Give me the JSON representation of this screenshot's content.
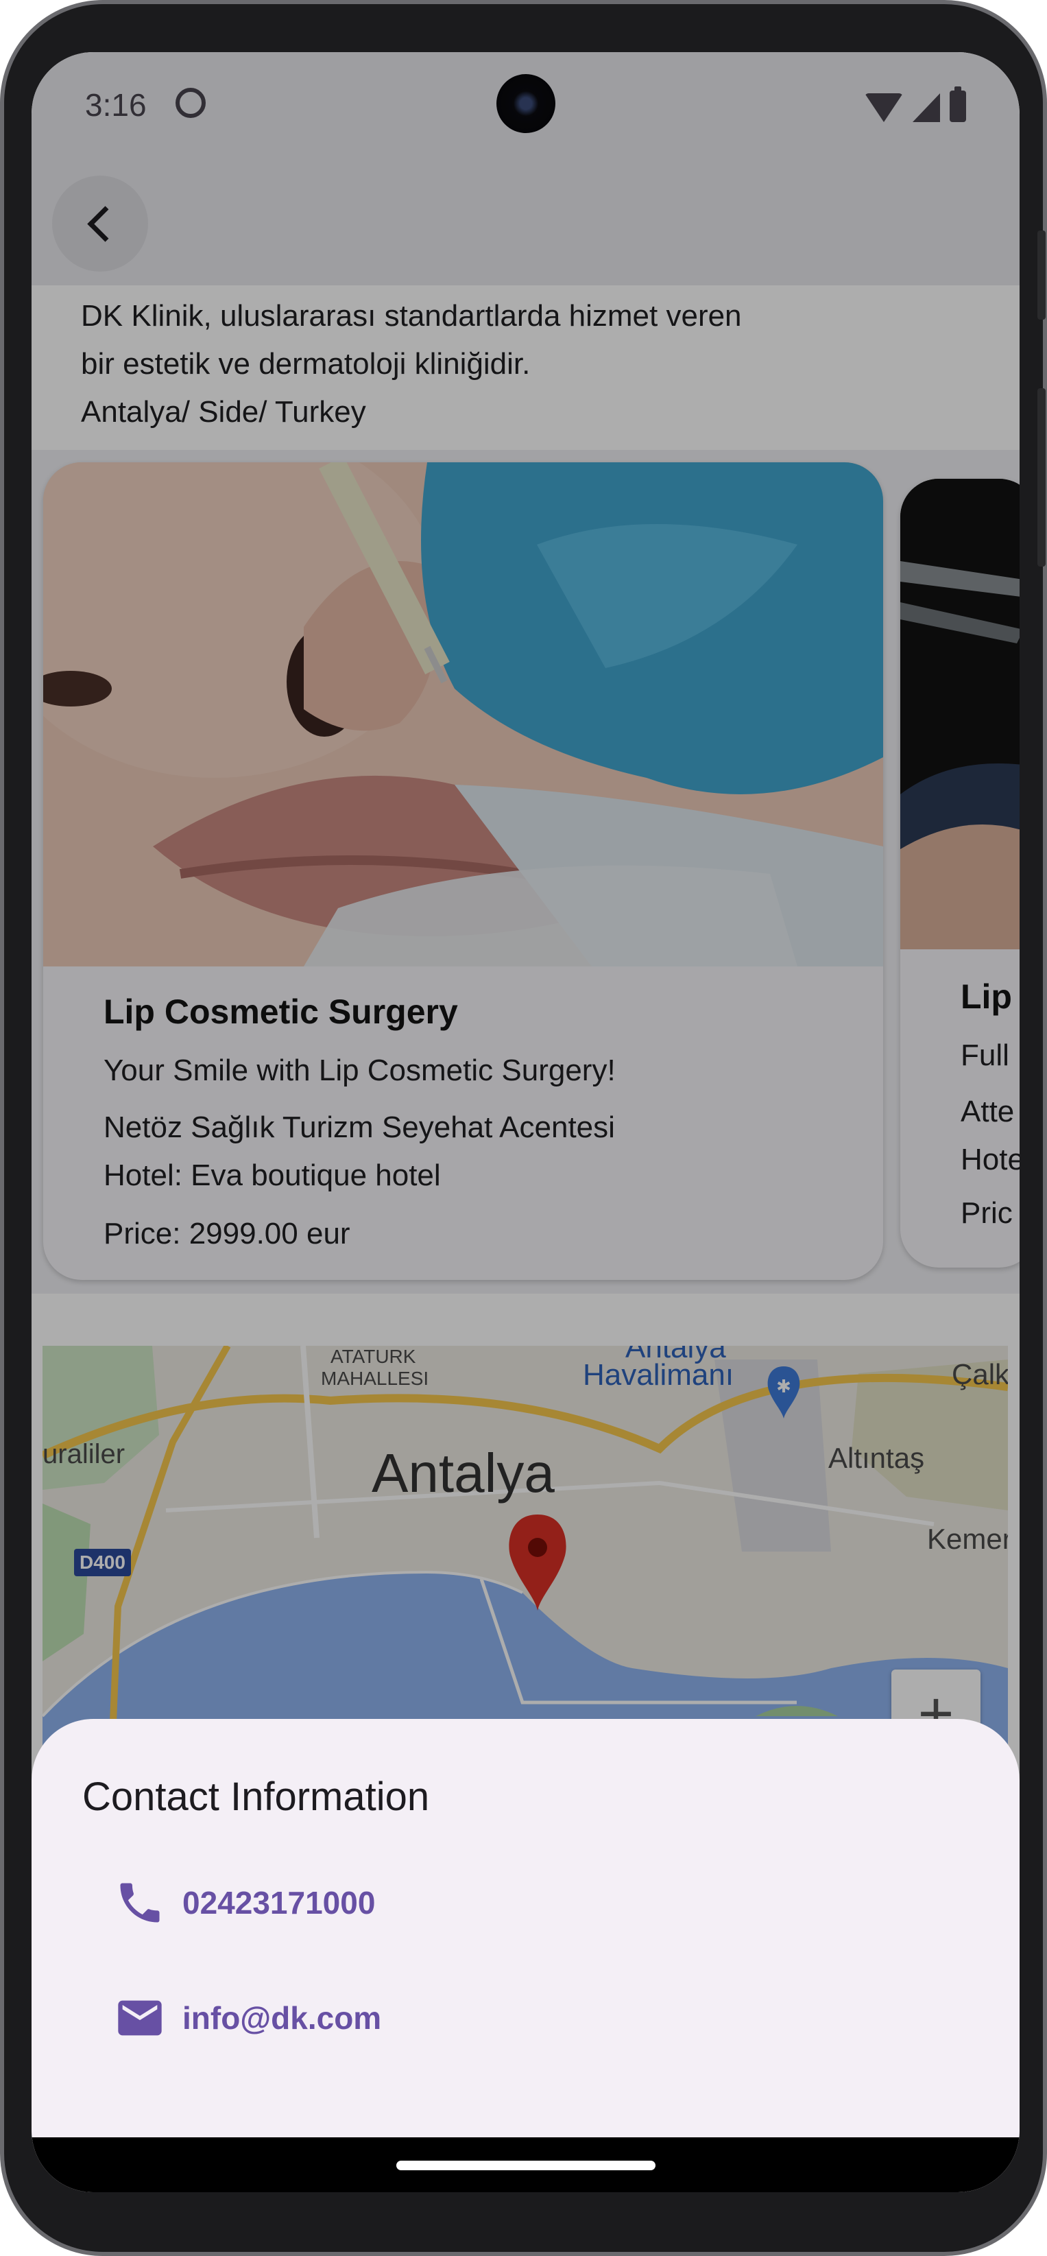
{
  "status_bar": {
    "time": "3:16"
  },
  "description": {
    "line1": "DK Klinik, uluslararası standartlarda hizmet veren",
    "line2": "bir estetik ve dermatoloji kliniğidir.",
    "line3": "Antalya/ Side/ Turkey"
  },
  "cards": [
    {
      "title": "Lip Cosmetic Surgery",
      "subtitle": "Your Smile with Lip Cosmetic Surgery!",
      "agency": "Netöz Sağlık Turizm Seyehat Acentesi",
      "hotel": "Hotel: Eva boutique hotel",
      "price": "Price:  2999.00 eur"
    },
    {
      "title": "Lip",
      "subtitle": "Full",
      "agency": "Atte",
      "hotel": "Hote",
      "price": "Pric"
    }
  ],
  "map": {
    "labels": {
      "ataturk": "ATATURK",
      "mahallesi": "MAHALLESI",
      "airport_top": "Antalya",
      "airport": "Havalimanı",
      "calk": "Çalk",
      "uraliler": "uraliler",
      "antalya": "Antalya",
      "altintas": "Altıntaş",
      "kemer": "Kemer",
      "road": "D400"
    },
    "zoom_in": "+"
  },
  "contact_sheet": {
    "title": "Contact Information",
    "phone": "02423171000",
    "email": "info@dk.com"
  }
}
